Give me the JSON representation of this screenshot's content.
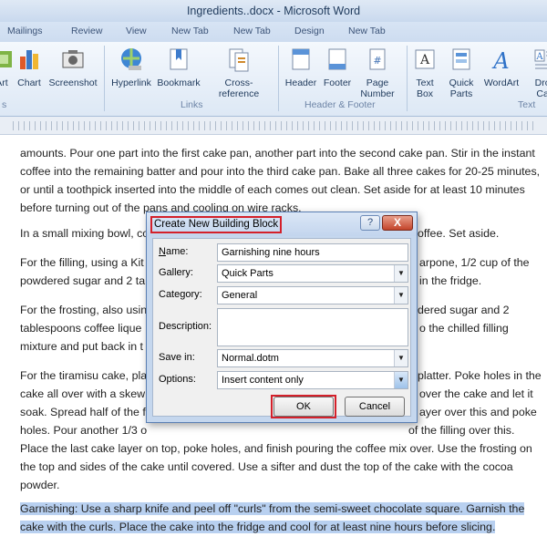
{
  "window": {
    "title": "Ingredients..docx - Microsoft Word"
  },
  "tabs": [
    "Mailings",
    "Review",
    "View",
    "New Tab",
    "New Tab",
    "Design",
    "New Tab"
  ],
  "ribbon": {
    "buttons": [
      {
        "label": "Art",
        "icon": "smartart-icon"
      },
      {
        "label": "Chart",
        "icon": "chart-icon"
      },
      {
        "label": "Screenshot",
        "icon": "screenshot-icon"
      },
      {
        "label": "Hyperlink",
        "icon": "hyperlink-icon"
      },
      {
        "label": "Bookmark",
        "icon": "bookmark-icon"
      },
      {
        "label": "Cross-reference",
        "icon": "cross-reference-icon"
      },
      {
        "label": "Header",
        "icon": "header-icon"
      },
      {
        "label": "Footer",
        "icon": "footer-icon"
      },
      {
        "label": "Page",
        "label2": "Number",
        "icon": "page-number-icon"
      },
      {
        "label": "Text",
        "label2": "Box",
        "icon": "text-box-icon"
      },
      {
        "label": "Quick",
        "label2": "Parts",
        "icon": "quick-parts-icon"
      },
      {
        "label": "WordArt",
        "icon": "wordart-icon"
      },
      {
        "label": "Drop",
        "label2": "Cap",
        "icon": "drop-cap-icon"
      }
    ],
    "groups": {
      "links": "Links",
      "header_footer": "Header & Footer",
      "text": "Text",
      "left_cut": "s"
    }
  },
  "document": {
    "paragraphs": [
      "amounts. Pour one part into the first cake pan, another part into the second cake pan. Stir in the instant coffee into the remaining batter and pour into the third cake pan. Bake all three cakes for 20-25 minutes, or until a toothpick inserted into the middle of each comes out clean. Set aside for at least 10 minutes before turning out of the pans and cooling on wire racks.",
      "In a small mixing bowl, co",
      "offee. Set aside.",
      "For the filling, using a Kit",
      "arpone, 1/2 cup of the",
      "powdered sugar and 2 ta",
      "in the fridge.",
      "For the frosting, also usin",
      "dered sugar and 2",
      "tablespoons coffee lique",
      "o the chilled filling",
      "mixture and put back in t",
      "For the tiramisu cake, pla",
      "platter. Poke holes in the",
      "cake all over with a skew",
      "over the cake and let it",
      "soak. Spread half of the f",
      "ayer over this and poke",
      "holes. Pour another 1/3 o",
      "of the filling over this.",
      "Place the last cake layer on top, poke holes, and finish pouring the coffee mix over. Use the frosting on the top and sides of the cake until covered. Use a sifter and dust the top of the cake with the cocoa powder.",
      "Garnishing: Use a sharp knife and peel off \"curls\" from the semi-sweet chocolate square. Garnish the cake with the curls. Place the cake into the fridge and cool for at least nine hours before slicing."
    ]
  },
  "dialog": {
    "title": "Create New Building Block",
    "help": "?",
    "close": "X",
    "fields": {
      "name_label": "Name:",
      "name_value": "Garnishing nine hours",
      "gallery_label": "Gallery:",
      "gallery_value": "Quick Parts",
      "category_label": "Category:",
      "category_value": "General",
      "description_label": "Description:",
      "description_value": "",
      "save_in_label": "Save in:",
      "save_in_value": "Normal.dotm",
      "options_label": "Options:",
      "options_value": "Insert content only"
    },
    "ok": "OK",
    "cancel": "Cancel"
  },
  "colors": {
    "highlight": "#d4202a",
    "selection": "#b8d0f0",
    "ribbon": "#dde8f5"
  }
}
